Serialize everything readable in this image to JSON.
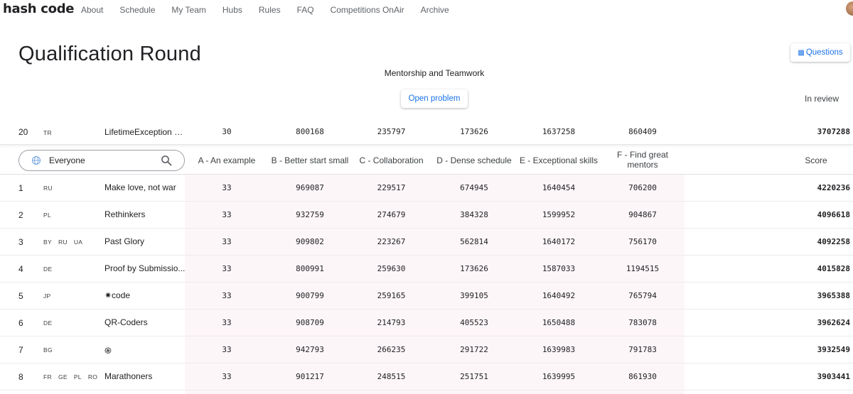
{
  "nav": {
    "brand": "hash code",
    "links": [
      "About",
      "Schedule",
      "My Team",
      "Hubs",
      "Rules",
      "FAQ",
      "Competitions OnAir",
      "Archive"
    ]
  },
  "header": {
    "title": "Qualification Round",
    "questions_label": "Questions",
    "problem_name": "Mentorship and Teamwork",
    "open_problem_label": "Open problem",
    "review_status": "In review"
  },
  "my_team": {
    "rank": "20",
    "countries": [
      "TR"
    ],
    "team": "LifetimeException 0...",
    "a": "30",
    "b": "800168",
    "c": "235797",
    "d": "173626",
    "e": "1637258",
    "f": "860409",
    "score": "3707288"
  },
  "filter": {
    "placeholder": "Everyone",
    "icons": [
      "globe-icon",
      "search-icon"
    ]
  },
  "columns": {
    "a": "A - An example",
    "b": "B - Better start small",
    "c": "C - Collaboration",
    "d": "D - Dense schedule",
    "e": "E - Exceptional skills",
    "f_line1": "F - Find great",
    "f_line2": "mentors",
    "score": "Score"
  },
  "colors": {
    "accent": "#1a73e8",
    "band": "#fdf6f9"
  },
  "rows": [
    {
      "rank": "1",
      "countries": [
        "RU"
      ],
      "team": "Make love, not war",
      "a": "33",
      "b": "969087",
      "c": "229517",
      "d": "674945",
      "e": "1640454",
      "f": "706200",
      "score": "4220236"
    },
    {
      "rank": "2",
      "countries": [
        "PL"
      ],
      "team": "Rethinkers",
      "a": "33",
      "b": "932759",
      "c": "274679",
      "d": "384328",
      "e": "1599952",
      "f": "904867",
      "score": "4096618"
    },
    {
      "rank": "3",
      "countries": [
        "BY",
        "RU",
        "UA"
      ],
      "team": "Past Glory",
      "a": "33",
      "b": "909802",
      "c": "223267",
      "d": "562814",
      "e": "1640172",
      "f": "756170",
      "score": "4092258"
    },
    {
      "rank": "4",
      "countries": [
        "DE"
      ],
      "team": "Proof by Submissio...",
      "a": "33",
      "b": "800991",
      "c": "259630",
      "d": "173626",
      "e": "1587033",
      "f": "1194515",
      "score": "4015828"
    },
    {
      "rank": "5",
      "countries": [
        "JP"
      ],
      "team": "✷code",
      "a": "33",
      "b": "900799",
      "c": "259165",
      "d": "399105",
      "e": "1640492",
      "f": "765794",
      "score": "3965388"
    },
    {
      "rank": "6",
      "countries": [
        "DE"
      ],
      "team": "QR-Coders",
      "a": "33",
      "b": "908709",
      "c": "214793",
      "d": "405523",
      "e": "1650488",
      "f": "783078",
      "score": "3962624"
    },
    {
      "rank": "7",
      "countries": [
        "BG"
      ],
      "team": "֍",
      "a": "33",
      "b": "942793",
      "c": "266235",
      "d": "291722",
      "e": "1639983",
      "f": "791783",
      "score": "3932549"
    },
    {
      "rank": "8",
      "countries": [
        "FR",
        "GE",
        "PL",
        "RO"
      ],
      "team": "Marathoners",
      "a": "33",
      "b": "901217",
      "c": "248515",
      "d": "251751",
      "e": "1639995",
      "f": "861930",
      "score": "3903441"
    }
  ]
}
